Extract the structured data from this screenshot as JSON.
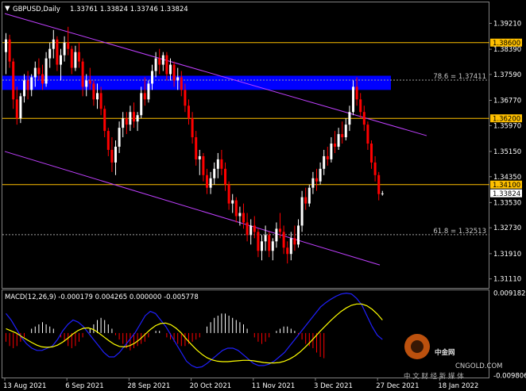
{
  "header": {
    "symbol": "GBPUSD,Daily",
    "ohlc": "1.33761 1.33824 1.33746 1.33824"
  },
  "colors": {
    "background": "#000000",
    "bull": "#ffffff",
    "bear": "#ff0000",
    "channel": "#c040ff",
    "hline": "#ffc000",
    "zone": "#0000ff",
    "dotted": "#a0a0a0",
    "macd_line": "#2020ff",
    "signal_line": "#ffff00",
    "price_box": "#ffffff",
    "axis_text": "#ffffff"
  },
  "chart_data": [
    {
      "type": "candlestick",
      "title": "GBPUSD,Daily",
      "ylim": [
        1.3085,
        1.3985
      ],
      "y_ticks": [
        "1.39210",
        "1.38390",
        "1.37590",
        "1.36770",
        "1.35970",
        "1.35150",
        "1.34350",
        "1.33530",
        "1.32730",
        "1.31910",
        "1.31110"
      ],
      "x_labels": [
        "13 Aug 2021",
        "6 Sep 2021",
        "28 Sep 2021",
        "20 Oct 2021",
        "11 Nov 2021",
        "3 Dec 2021",
        "27 Dec 2021",
        "18 Jan 2022"
      ],
      "x_label_positions": [
        0,
        17,
        34,
        51,
        68,
        85,
        102,
        119
      ],
      "resistance_support": [
        {
          "label": "1.38600",
          "value": 1.386
        },
        {
          "label": "1.36200",
          "value": 1.362
        },
        {
          "label": "1.34100",
          "value": 1.341
        }
      ],
      "current_price": {
        "label": "1.33824",
        "value": 1.33824
      },
      "fibonacci": [
        {
          "label": "78.6 = 1.37411",
          "value": 1.37411
        },
        {
          "label": "61.8 = 1.32513",
          "value": 1.32513
        }
      ],
      "zone": {
        "from": 1.371,
        "to": 1.3755
      },
      "channel_upper": [
        [
          0,
          1.3952
        ],
        [
          135,
          1.3565
        ]
      ],
      "channel_lower": [
        [
          0,
          1.3515
        ],
        [
          120,
          1.3155
        ]
      ],
      "ohlc": [
        [
          1.383,
          1.389,
          1.376,
          1.387
        ],
        [
          1.387,
          1.3885,
          1.378,
          1.38
        ],
        [
          1.38,
          1.381,
          1.365,
          1.368
        ],
        [
          1.368,
          1.372,
          1.36,
          1.362
        ],
        [
          1.362,
          1.37,
          1.3605,
          1.369
        ],
        [
          1.369,
          1.376,
          1.367,
          1.374
        ],
        [
          1.374,
          1.377,
          1.368,
          1.371
        ],
        [
          1.371,
          1.376,
          1.369,
          1.375
        ],
        [
          1.375,
          1.38,
          1.372,
          1.378
        ],
        [
          1.378,
          1.381,
          1.374,
          1.376
        ],
        [
          1.376,
          1.379,
          1.371,
          1.373
        ],
        [
          1.373,
          1.383,
          1.372,
          1.381
        ],
        [
          1.381,
          1.386,
          1.378,
          1.384
        ],
        [
          1.384,
          1.39,
          1.381,
          1.387
        ],
        [
          1.387,
          1.388,
          1.377,
          1.379
        ],
        [
          1.379,
          1.384,
          1.374,
          1.382
        ],
        [
          1.382,
          1.388,
          1.38,
          1.386
        ],
        [
          1.386,
          1.391,
          1.382,
          1.384
        ],
        [
          1.384,
          1.385,
          1.376,
          1.378
        ],
        [
          1.378,
          1.385,
          1.377,
          1.383
        ],
        [
          1.383,
          1.386,
          1.378,
          1.38
        ],
        [
          1.38,
          1.381,
          1.369,
          1.372
        ],
        [
          1.372,
          1.376,
          1.369,
          1.374
        ],
        [
          1.374,
          1.378,
          1.371,
          1.373
        ],
        [
          1.373,
          1.374,
          1.366,
          1.368
        ],
        [
          1.368,
          1.373,
          1.365,
          1.37
        ],
        [
          1.37,
          1.372,
          1.363,
          1.365
        ],
        [
          1.365,
          1.366,
          1.356,
          1.358
        ],
        [
          1.358,
          1.359,
          1.35,
          1.352
        ],
        [
          1.352,
          1.356,
          1.345,
          1.348
        ],
        [
          1.348,
          1.355,
          1.344,
          1.353
        ],
        [
          1.353,
          1.361,
          1.351,
          1.359
        ],
        [
          1.359,
          1.364,
          1.356,
          1.362
        ],
        [
          1.362,
          1.364,
          1.357,
          1.36
        ],
        [
          1.36,
          1.366,
          1.358,
          1.364
        ],
        [
          1.364,
          1.367,
          1.359,
          1.361
        ],
        [
          1.361,
          1.364,
          1.358,
          1.363
        ],
        [
          1.363,
          1.372,
          1.362,
          1.37
        ],
        [
          1.37,
          1.375,
          1.366,
          1.368
        ],
        [
          1.368,
          1.374,
          1.367,
          1.373
        ],
        [
          1.373,
          1.379,
          1.371,
          1.377
        ],
        [
          1.377,
          1.383,
          1.375,
          1.381
        ],
        [
          1.381,
          1.384,
          1.376,
          1.379
        ],
        [
          1.379,
          1.383,
          1.377,
          1.382
        ],
        [
          1.382,
          1.383,
          1.374,
          1.376
        ],
        [
          1.376,
          1.381,
          1.374,
          1.379
        ],
        [
          1.379,
          1.38,
          1.372,
          1.374
        ],
        [
          1.374,
          1.378,
          1.371,
          1.375
        ],
        [
          1.375,
          1.377,
          1.369,
          1.371
        ],
        [
          1.371,
          1.373,
          1.364,
          1.366
        ],
        [
          1.366,
          1.368,
          1.36,
          1.362
        ],
        [
          1.362,
          1.364,
          1.354,
          1.356
        ],
        [
          1.356,
          1.358,
          1.347,
          1.349
        ],
        [
          1.349,
          1.352,
          1.344,
          1.35
        ],
        [
          1.35,
          1.351,
          1.342,
          1.344
        ],
        [
          1.344,
          1.346,
          1.338,
          1.34
        ],
        [
          1.34,
          1.345,
          1.338,
          1.343
        ],
        [
          1.343,
          1.348,
          1.341,
          1.346
        ],
        [
          1.346,
          1.351,
          1.343,
          1.349
        ],
        [
          1.349,
          1.352,
          1.344,
          1.346
        ],
        [
          1.346,
          1.348,
          1.339,
          1.341
        ],
        [
          1.341,
          1.342,
          1.333,
          1.335
        ],
        [
          1.335,
          1.338,
          1.332,
          1.336
        ],
        [
          1.336,
          1.337,
          1.329,
          1.331
        ],
        [
          1.331,
          1.334,
          1.328,
          1.332
        ],
        [
          1.332,
          1.335,
          1.327,
          1.329
        ],
        [
          1.329,
          1.332,
          1.323,
          1.325
        ],
        [
          1.325,
          1.33,
          1.322,
          1.328
        ],
        [
          1.328,
          1.331,
          1.324,
          1.326
        ],
        [
          1.326,
          1.327,
          1.318,
          1.32
        ],
        [
          1.32,
          1.325,
          1.317,
          1.323
        ],
        [
          1.323,
          1.328,
          1.32,
          1.325
        ],
        [
          1.325,
          1.326,
          1.318,
          1.32
        ],
        [
          1.32,
          1.324,
          1.317,
          1.323
        ],
        [
          1.323,
          1.329,
          1.321,
          1.327
        ],
        [
          1.327,
          1.332,
          1.324,
          1.326
        ],
        [
          1.326,
          1.328,
          1.319,
          1.321
        ],
        [
          1.321,
          1.323,
          1.316,
          1.319
        ],
        [
          1.319,
          1.326,
          1.317,
          1.324
        ],
        [
          1.324,
          1.328,
          1.32,
          1.322
        ],
        [
          1.322,
          1.33,
          1.321,
          1.328
        ],
        [
          1.328,
          1.339,
          1.326,
          1.337
        ],
        [
          1.337,
          1.34,
          1.333,
          1.335
        ],
        [
          1.335,
          1.341,
          1.334,
          1.34
        ],
        [
          1.34,
          1.345,
          1.338,
          1.343
        ],
        [
          1.343,
          1.346,
          1.339,
          1.342
        ],
        [
          1.342,
          1.348,
          1.341,
          1.346
        ],
        [
          1.346,
          1.352,
          1.344,
          1.35
        ],
        [
          1.35,
          1.353,
          1.347,
          1.349
        ],
        [
          1.349,
          1.356,
          1.348,
          1.354
        ],
        [
          1.354,
          1.358,
          1.351,
          1.353
        ],
        [
          1.353,
          1.359,
          1.352,
          1.357
        ],
        [
          1.357,
          1.361,
          1.354,
          1.356
        ],
        [
          1.356,
          1.362,
          1.355,
          1.36
        ],
        [
          1.36,
          1.366,
          1.358,
          1.364
        ],
        [
          1.364,
          1.374,
          1.363,
          1.372
        ],
        [
          1.372,
          1.375,
          1.366,
          1.368
        ],
        [
          1.368,
          1.37,
          1.362,
          1.364
        ],
        [
          1.364,
          1.366,
          1.358,
          1.36
        ],
        [
          1.36,
          1.361,
          1.352,
          1.354
        ],
        [
          1.354,
          1.355,
          1.346,
          1.348
        ],
        [
          1.348,
          1.35,
          1.342,
          1.344
        ],
        [
          1.344,
          1.345,
          1.336,
          1.338
        ],
        [
          1.338,
          1.339,
          1.3375,
          1.3382
        ]
      ],
      "macd_panel": {
        "label": "MACD(12,26,9) -0.000179 0.004265 0.000000 -0.005778",
        "y_ticks": [
          "0.009182",
          "-0.009806"
        ],
        "ylim": [
          -0.0099,
          0.0095
        ],
        "histogram": [
          -0.002,
          -0.003,
          -0.0035,
          -0.003,
          -0.002,
          -0.001,
          0.0,
          0.001,
          0.0015,
          0.002,
          0.0025,
          0.002,
          0.0015,
          0.001,
          0.0,
          -0.001,
          -0.002,
          -0.003,
          -0.0035,
          -0.003,
          -0.002,
          -0.001,
          0.0,
          0.001,
          0.002,
          0.003,
          0.0035,
          0.003,
          0.002,
          0.001,
          -0.0005,
          -0.0015,
          -0.0025,
          -0.0035,
          -0.004,
          -0.0035,
          -0.003,
          -0.0025,
          -0.002,
          -0.001,
          0.0,
          0.0005,
          0.0005,
          0.0,
          -0.001,
          -0.0015,
          -0.002,
          -0.0025,
          -0.003,
          -0.003,
          -0.0025,
          -0.002,
          -0.0015,
          -0.001,
          0.0,
          0.0015,
          0.0025,
          0.0035,
          0.004,
          0.0045,
          0.0045,
          0.004,
          0.0035,
          0.003,
          0.0025,
          0.002,
          0.001,
          0.0,
          -0.001,
          -0.002,
          -0.0025,
          -0.002,
          -0.001,
          0.0,
          0.0005,
          0.001,
          0.0015,
          0.0015,
          0.001,
          0.0005,
          -0.0005,
          -0.0015,
          -0.0025,
          -0.003,
          -0.0035,
          -0.0045,
          -0.0055,
          -0.0058
        ],
        "macd_line": [
          0.0045,
          0.003,
          0.001,
          -0.001,
          -0.0025,
          -0.0035,
          -0.004,
          -0.004,
          -0.0035,
          -0.003,
          -0.0015,
          0.0005,
          0.002,
          0.003,
          0.0025,
          0.0015,
          0.0,
          -0.0015,
          -0.003,
          -0.0045,
          -0.0055,
          -0.0055,
          -0.0045,
          -0.003,
          -0.0015,
          0.0,
          0.002,
          0.004,
          0.005,
          0.0045,
          0.003,
          0.0015,
          -0.0005,
          -0.0025,
          -0.0045,
          -0.0065,
          -0.0075,
          -0.008,
          -0.0078,
          -0.007,
          -0.006,
          -0.005,
          -0.004,
          -0.0035,
          -0.0035,
          -0.004,
          -0.005,
          -0.006,
          -0.007,
          -0.0075,
          -0.0075,
          -0.0072,
          -0.0065,
          -0.0055,
          -0.0045,
          -0.003,
          -0.0015,
          0.0,
          0.0015,
          0.003,
          0.0045,
          0.006,
          0.007,
          0.0078,
          0.0085,
          0.009,
          0.0092,
          0.009,
          0.008,
          0.0065,
          0.004,
          0.0015,
          -0.0005,
          -0.0015
        ],
        "signal_line": [
          0.001,
          0.0005,
          0.0,
          -0.0008,
          -0.0015,
          -0.0022,
          -0.0028,
          -0.0032,
          -0.0033,
          -0.0032,
          -0.0028,
          -0.0021,
          -0.0012,
          -0.0002,
          0.0006,
          0.0011,
          0.0012,
          0.0008,
          0.0,
          -0.0009,
          -0.0018,
          -0.0026,
          -0.0031,
          -0.0032,
          -0.0029,
          -0.0023,
          -0.0014,
          -0.0003,
          0.0008,
          0.0017,
          0.0022,
          0.0023,
          0.0019,
          0.0011,
          0.0,
          -0.0014,
          -0.0027,
          -0.0039,
          -0.0049,
          -0.0057,
          -0.0062,
          -0.0065,
          -0.0066,
          -0.0066,
          -0.0065,
          -0.0064,
          -0.0063,
          -0.0063,
          -0.0064,
          -0.0066,
          -0.0068,
          -0.0069,
          -0.0069,
          -0.0068,
          -0.0065,
          -0.006,
          -0.0053,
          -0.0044,
          -0.0033,
          -0.0021,
          -0.0008,
          0.0005,
          0.0017,
          0.0029,
          0.004,
          0.005,
          0.0058,
          0.0064,
          0.0067,
          0.0067,
          0.0063,
          0.0055,
          0.0044,
          0.003
        ]
      }
    }
  ],
  "watermark": {
    "brand": "中金网",
    "site": "CNGOLD.COM",
    "slogan": "中 文 财 经 新 媒 体"
  }
}
